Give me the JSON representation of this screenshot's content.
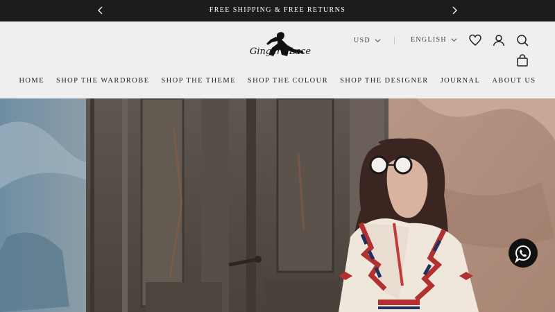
{
  "announcement": {
    "text": "FREE SHIPPING & FREE RETURNS",
    "prev_icon": "chevron-left-icon",
    "next_icon": "chevron-right-icon"
  },
  "header": {
    "logo_text": "Ginger&Lace",
    "currency": "USD",
    "language": "ENGLISH",
    "icons": [
      "heart-icon",
      "account-icon",
      "search-icon",
      "cart-icon"
    ]
  },
  "nav": {
    "items": [
      "HOME",
      "SHOP THE WARDROBE",
      "SHOP THE THEME",
      "SHOP THE COLOUR",
      "SHOP THE DESIGNER",
      "JOURNAL",
      "ABOUT US"
    ]
  },
  "hero": {
    "image": "woman-in-sunglasses-before-weathered-doors"
  },
  "floating": {
    "icon": "whatsapp-icon"
  },
  "colors": {
    "announcement_bg": "#1c1c1c",
    "header_bg": "#efefef",
    "text": "#1f1f1f"
  }
}
